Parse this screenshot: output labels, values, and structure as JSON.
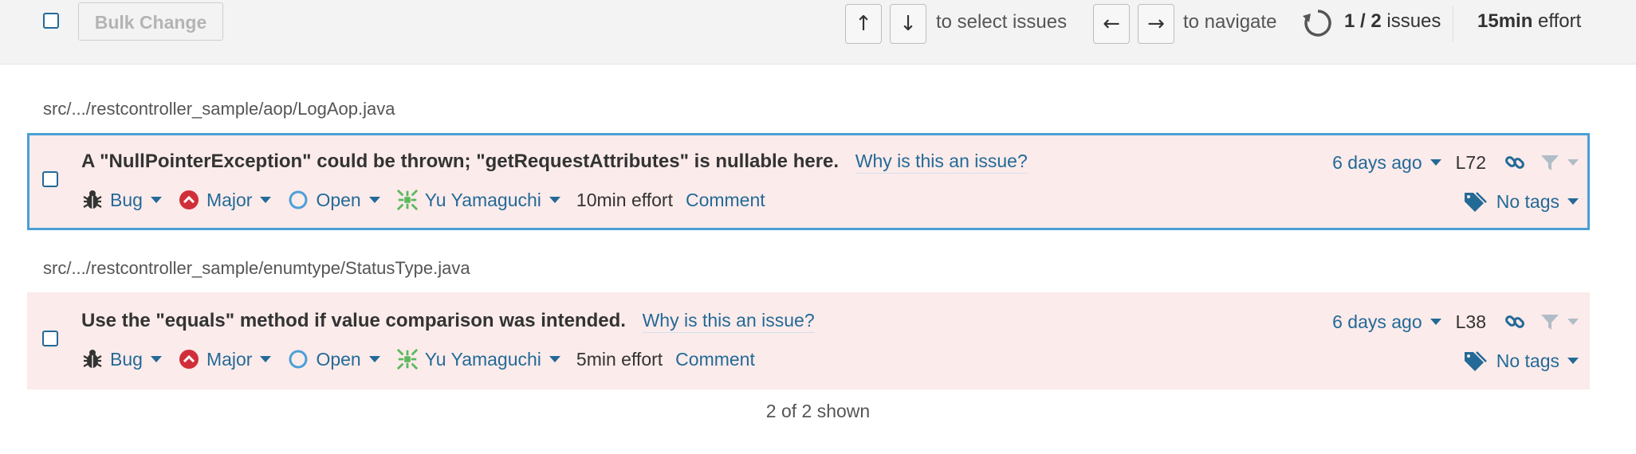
{
  "toolbar": {
    "bulk_change_label": "Bulk Change",
    "key_up": "↑",
    "key_down": "↓",
    "select_hint": "to select issues",
    "key_left": "←",
    "key_right": "→",
    "navigate_hint": "to navigate",
    "issues_count": "1 / 2",
    "issues_suffix": "issues",
    "total_effort_value": "15min",
    "total_effort_suffix": "effort"
  },
  "issues": [
    {
      "file_path": "src/.../restcontroller_sample/aop/LogAop.java",
      "message": "A \"NullPointerException\" could be thrown; \"getRequestAttributes\" is nullable here.",
      "why_link": "Why is this an issue?",
      "type": "Bug",
      "severity": "Major",
      "status": "Open",
      "assignee": "Yu Yamaguchi",
      "effort": "10min effort",
      "comment_link": "Comment",
      "date": "6 days ago",
      "line": "L72",
      "tags": "No tags",
      "selected": true
    },
    {
      "file_path": "src/.../restcontroller_sample/enumtype/StatusType.java",
      "message": "Use the \"equals\" method if value comparison was intended.",
      "why_link": "Why is this an issue?",
      "type": "Bug",
      "severity": "Major",
      "status": "Open",
      "assignee": "Yu Yamaguchi",
      "effort": "5min effort",
      "comment_link": "Comment",
      "date": "6 days ago",
      "line": "L38",
      "tags": "No tags",
      "selected": false
    }
  ],
  "footer": {
    "shown_text": "2 of 2 shown"
  },
  "colors": {
    "link": "#236a97",
    "issue_bg": "#fcebeb",
    "selected_border": "#4b9fd5",
    "severity_major": "#d02f3a",
    "avatar": "#5cb85c"
  }
}
